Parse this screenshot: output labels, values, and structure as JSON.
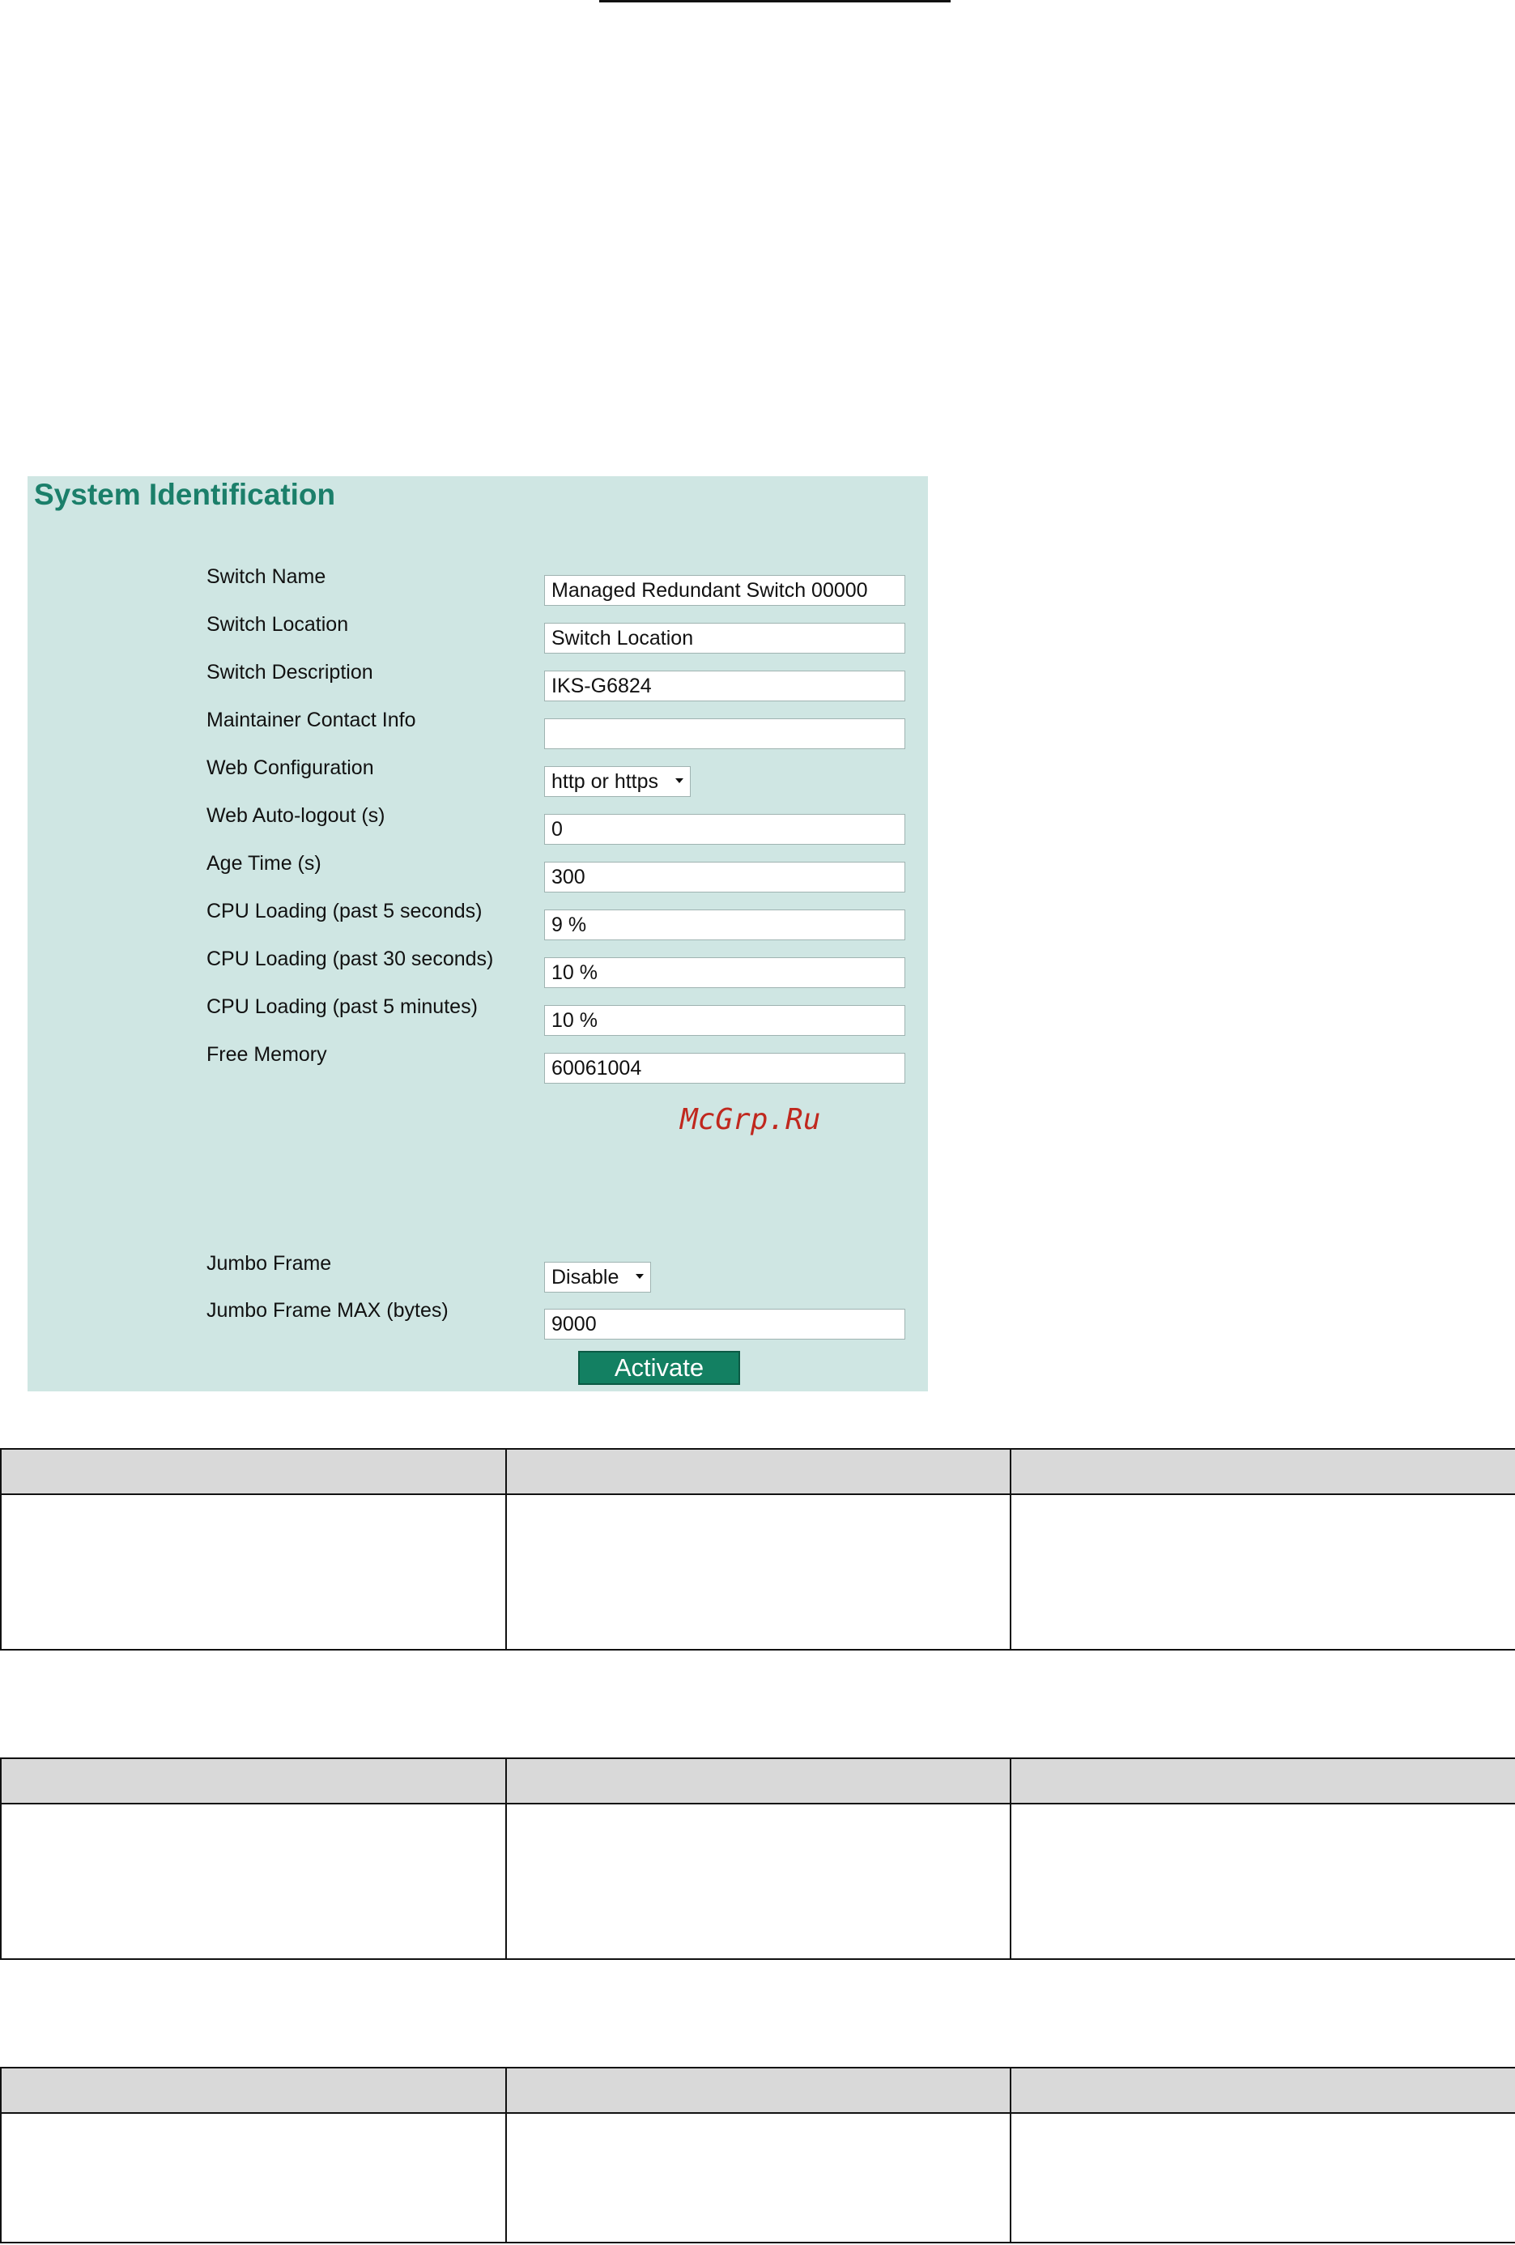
{
  "panel": {
    "title": "System Identification",
    "fields": [
      {
        "label": "Switch Name",
        "value": "Managed Redundant Switch 00000",
        "kind": "text"
      },
      {
        "label": "Switch Location",
        "value": "Switch Location",
        "kind": "text"
      },
      {
        "label": "Switch Description",
        "value": "IKS-G6824",
        "kind": "text"
      },
      {
        "label": "Maintainer Contact Info",
        "value": "",
        "kind": "text"
      },
      {
        "label": "Web Configuration",
        "value": "http or https",
        "kind": "select"
      },
      {
        "label": "Web Auto-logout (s)",
        "value": "0",
        "kind": "text"
      },
      {
        "label": "Age Time (s)",
        "value": "300",
        "kind": "text"
      },
      {
        "label": "CPU Loading (past 5 seconds)",
        "value": "9 %",
        "kind": "text"
      },
      {
        "label": "CPU Loading (past 30 seconds)",
        "value": "10 %",
        "kind": "text"
      },
      {
        "label": "CPU Loading (past 5 minutes)",
        "value": "10 %",
        "kind": "text"
      },
      {
        "label": "Free Memory",
        "value": "60061004",
        "kind": "text"
      },
      {
        "label": "Jumbo Frame",
        "value": "Disable",
        "kind": "select"
      },
      {
        "label": "Jumbo Frame MAX (bytes)",
        "value": "9000",
        "kind": "text"
      }
    ],
    "watermark": "McGrp.Ru",
    "activate_label": "Activate"
  },
  "colors": {
    "panel_background": "#cfe6e3",
    "title": "#1b7f6a",
    "button": "#138062",
    "watermark": "#c0281e",
    "table_header": "#d9d9d9"
  }
}
